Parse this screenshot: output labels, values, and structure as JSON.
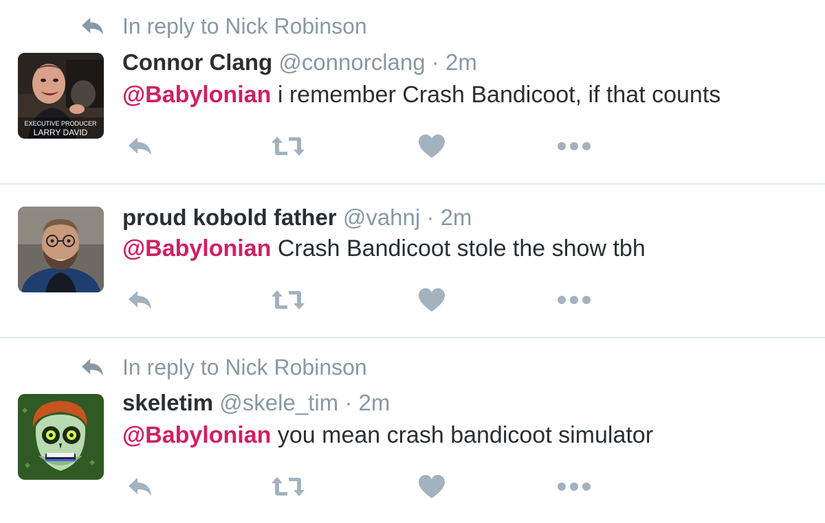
{
  "colors": {
    "mention": "#d0205f",
    "muted": "#8899a6",
    "text": "#292f33",
    "icon": "#a3b2bf",
    "divider": "#e1e8ed"
  },
  "tweets": [
    {
      "context": "In reply to Nick Robinson",
      "name": "Connor Clang",
      "handle": "@connorclang",
      "separator": "·",
      "time": "2m",
      "mention": "@Babylonian",
      "text": " i remember Crash Bandicoot, if that counts",
      "avatar_caption_line1": "EXECUTIVE PRODUCER",
      "avatar_caption_line2": "LARRY DAVID",
      "icons": [
        "reply-icon",
        "retweet-icon",
        "like-icon",
        "more-icon"
      ]
    },
    {
      "name": "proud kobold father",
      "handle": "@vahnj",
      "separator": "·",
      "time": "2m",
      "mention": "@Babylonian",
      "text": " Crash Bandicoot stole the show tbh",
      "icons": [
        "reply-icon",
        "retweet-icon",
        "like-icon",
        "more-icon"
      ]
    },
    {
      "context": "In reply to Nick Robinson",
      "name": "skeletim",
      "handle": "@skele_tim",
      "separator": "·",
      "time": "2m",
      "mention": "@Babylonian",
      "text": " you mean crash bandicoot simulator",
      "icons": [
        "reply-icon",
        "retweet-icon",
        "like-icon",
        "more-icon"
      ]
    }
  ]
}
